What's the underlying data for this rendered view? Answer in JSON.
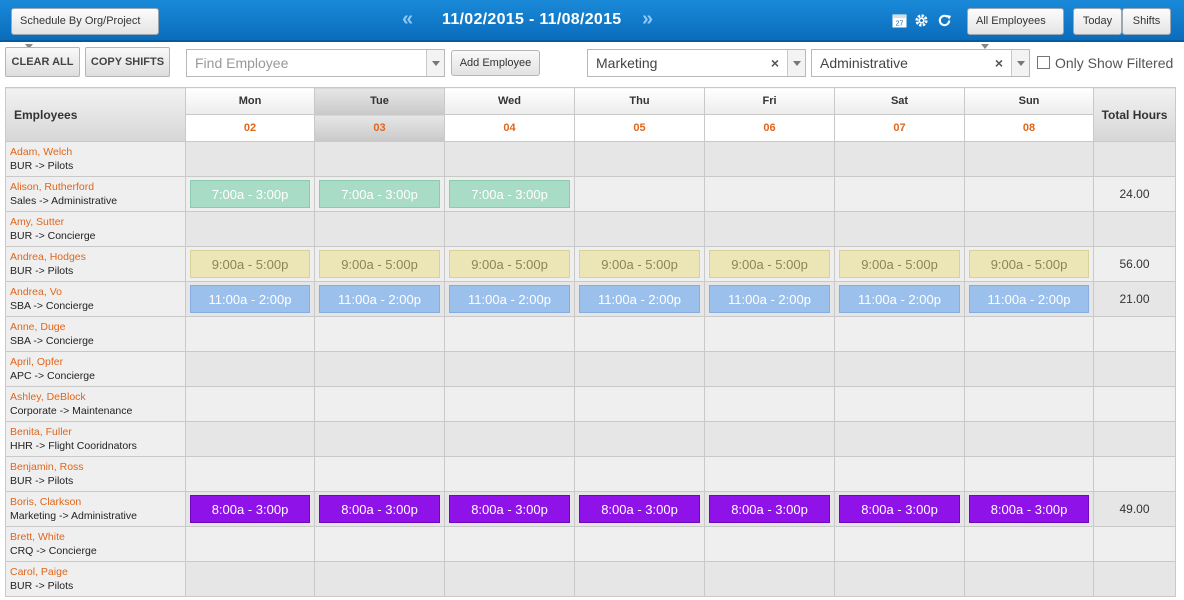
{
  "header": {
    "schedule_by": "Schedule By Org/Project",
    "date_range": "11/02/2015 - 11/08/2015",
    "prev_arrow": "«",
    "next_arrow": "»",
    "employee_filter": "All Employees",
    "today_label": "Today",
    "shifts_label": "Shifts",
    "calendar_icon_text": "27"
  },
  "toolbar": {
    "clear_all": "CLEAR ALL",
    "copy_shifts": "COPY SHIFTS",
    "find_employee_placeholder": "Find Employee",
    "add_employee": "Add Employee",
    "filter1": "Marketing",
    "filter2": "Administrative",
    "only_show_filtered": "Only Show Filtered"
  },
  "grid": {
    "employees_header": "Employees",
    "total_header": "Total Hours",
    "days": [
      {
        "name": "Mon",
        "num": "02"
      },
      {
        "name": "Tue",
        "num": "03"
      },
      {
        "name": "Wed",
        "num": "04"
      },
      {
        "name": "Thu",
        "num": "05"
      },
      {
        "name": "Fri",
        "num": "06"
      },
      {
        "name": "Sat",
        "num": "07"
      },
      {
        "name": "Sun",
        "num": "08"
      }
    ],
    "rows": [
      {
        "name": "Adam, Welch",
        "dept": "BUR -> Pilots",
        "total": "",
        "color": "",
        "shifts": [
          "",
          "",
          "",
          "",
          "",
          "",
          ""
        ]
      },
      {
        "name": "Alison, Rutherford",
        "dept": "Sales -> Administrative",
        "total": "24.00",
        "color": "green",
        "shifts": [
          "7:00a - 3:00p",
          "7:00a - 3:00p",
          "7:00a - 3:00p",
          "",
          "",
          "",
          ""
        ]
      },
      {
        "name": "Amy, Sutter",
        "dept": "BUR -> Concierge",
        "total": "",
        "color": "",
        "shifts": [
          "",
          "",
          "",
          "",
          "",
          "",
          ""
        ]
      },
      {
        "name": "Andrea, Hodges",
        "dept": "BUR -> Pilots",
        "total": "56.00",
        "color": "yellow",
        "shifts": [
          "9:00a - 5:00p",
          "9:00a - 5:00p",
          "9:00a - 5:00p",
          "9:00a - 5:00p",
          "9:00a - 5:00p",
          "9:00a - 5:00p",
          "9:00a - 5:00p"
        ]
      },
      {
        "name": "Andrea, Vo",
        "dept": "SBA -> Concierge",
        "total": "21.00",
        "color": "blue",
        "shifts": [
          "11:00a - 2:00p",
          "11:00a - 2:00p",
          "11:00a - 2:00p",
          "11:00a - 2:00p",
          "11:00a - 2:00p",
          "11:00a - 2:00p",
          "11:00a - 2:00p"
        ]
      },
      {
        "name": "Anne, Duge",
        "dept": "SBA -> Concierge",
        "total": "",
        "color": "",
        "shifts": [
          "",
          "",
          "",
          "",
          "",
          "",
          ""
        ]
      },
      {
        "name": "April, Opfer",
        "dept": "APC -> Concierge",
        "total": "",
        "color": "",
        "shifts": [
          "",
          "",
          "",
          "",
          "",
          "",
          ""
        ]
      },
      {
        "name": "Ashley, DeBlock",
        "dept": "Corporate -> Maintenance",
        "total": "",
        "color": "",
        "shifts": [
          "",
          "",
          "",
          "",
          "",
          "",
          ""
        ]
      },
      {
        "name": "Benita, Fuller",
        "dept": "HHR -> Flight Cooridnators",
        "total": "",
        "color": "",
        "shifts": [
          "",
          "",
          "",
          "",
          "",
          "",
          ""
        ]
      },
      {
        "name": "Benjamin, Ross",
        "dept": "BUR -> Pilots",
        "total": "",
        "color": "",
        "shifts": [
          "",
          "",
          "",
          "",
          "",
          "",
          ""
        ]
      },
      {
        "name": "Boris, Clarkson",
        "dept": "Marketing -> Administrative",
        "total": "49.00",
        "color": "purple",
        "shifts": [
          "8:00a - 3:00p",
          "8:00a - 3:00p",
          "8:00a - 3:00p",
          "8:00a - 3:00p",
          "8:00a - 3:00p",
          "8:00a - 3:00p",
          "8:00a - 3:00p"
        ]
      },
      {
        "name": "Brett, White",
        "dept": "CRQ -> Concierge",
        "total": "",
        "color": "",
        "shifts": [
          "",
          "",
          "",
          "",
          "",
          "",
          ""
        ]
      },
      {
        "name": "Carol, Paige",
        "dept": "BUR -> Pilots",
        "total": "",
        "color": "",
        "shifts": [
          "",
          "",
          "",
          "",
          "",
          "",
          ""
        ]
      }
    ]
  }
}
